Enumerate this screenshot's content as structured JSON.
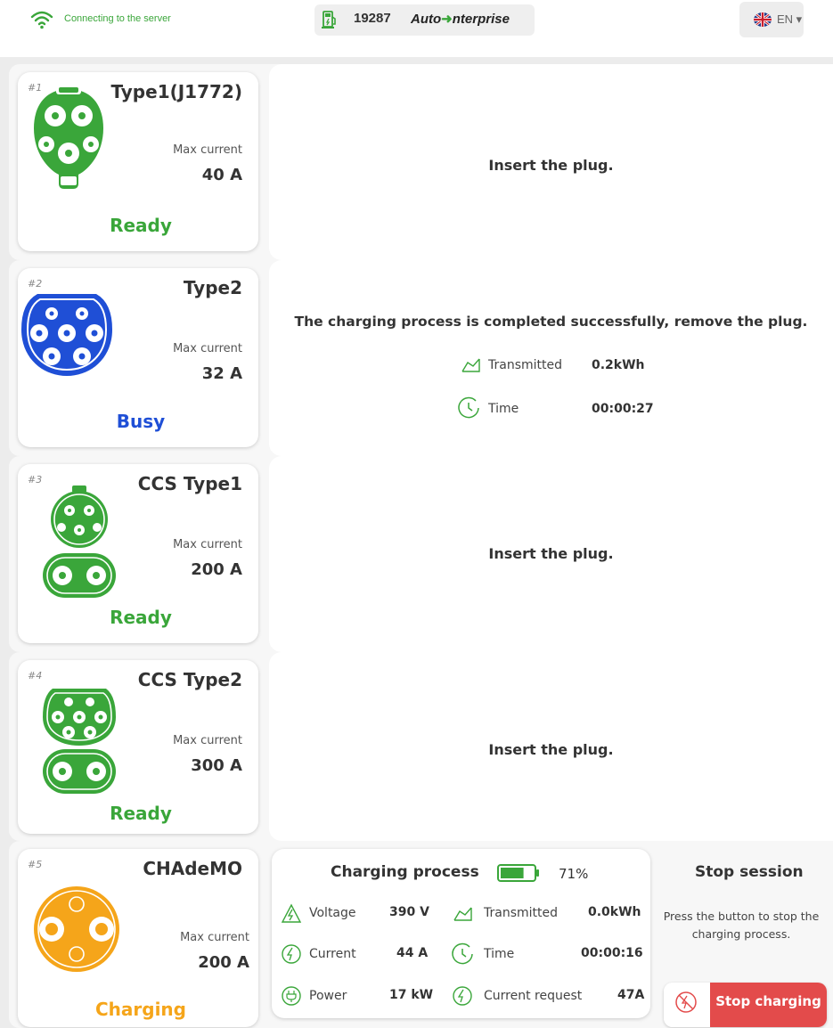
{
  "header": {
    "connection_status": "Connecting to the server",
    "station_id": "19287",
    "brand": {
      "part1": "Auto",
      "part2": "nterprise"
    },
    "language": "EN"
  },
  "connectors": [
    {
      "number": "#1",
      "name": "Type1(J1772)",
      "max_label": "Max current",
      "max_value": "40 A",
      "status": "Ready",
      "status_color": "#3aa63a",
      "message": "Insert the plug."
    },
    {
      "number": "#2",
      "name": "Type2",
      "max_label": "Max current",
      "max_value": "32 A",
      "status": "Busy",
      "status_color": "#1f4fd6",
      "message": "The charging process is completed successfully, remove the plug.",
      "stats": [
        {
          "icon": "energy-icon",
          "label": "Transmitted",
          "value": "0.2kWh"
        },
        {
          "icon": "clock-icon",
          "label": "Time",
          "value": "00:00:27"
        }
      ]
    },
    {
      "number": "#3",
      "name": "CCS Type1",
      "max_label": "Max current",
      "max_value": "200 A",
      "status": "Ready",
      "status_color": "#3aa63a",
      "message": "Insert the plug."
    },
    {
      "number": "#4",
      "name": "CCS Type2",
      "max_label": "Max current",
      "max_value": "300 A",
      "status": "Ready",
      "status_color": "#3aa63a",
      "message": "Insert the plug."
    },
    {
      "number": "#5",
      "name": "CHAdeMO",
      "max_label": "Max current",
      "max_value": "200 A",
      "status": "Charging",
      "status_color": "#f5a51a"
    }
  ],
  "charging": {
    "title": "Charging process",
    "battery_percent": "71%",
    "battery_level": 0.71,
    "metrics": [
      {
        "icon": "voltage-icon",
        "label": "Voltage",
        "value": "390 V"
      },
      {
        "icon": "energy-icon",
        "label": "Transmitted",
        "value": "0.0kWh"
      },
      {
        "icon": "current-icon",
        "label": "Current",
        "value": "44 A"
      },
      {
        "icon": "clock-icon",
        "label": "Time",
        "value": "00:00:16"
      },
      {
        "icon": "power-plug-icon",
        "label": "Power",
        "value": "17 kW"
      },
      {
        "icon": "current-icon",
        "label": "Current request",
        "value": "47A"
      }
    ]
  },
  "stop": {
    "title": "Stop session",
    "description": "Press the button to stop the charging process.",
    "button": "Stop charging"
  },
  "colors": {
    "green": "#3aa63a",
    "blue": "#1f4fd6",
    "orange": "#f5a51a",
    "red": "#e34b4b"
  }
}
